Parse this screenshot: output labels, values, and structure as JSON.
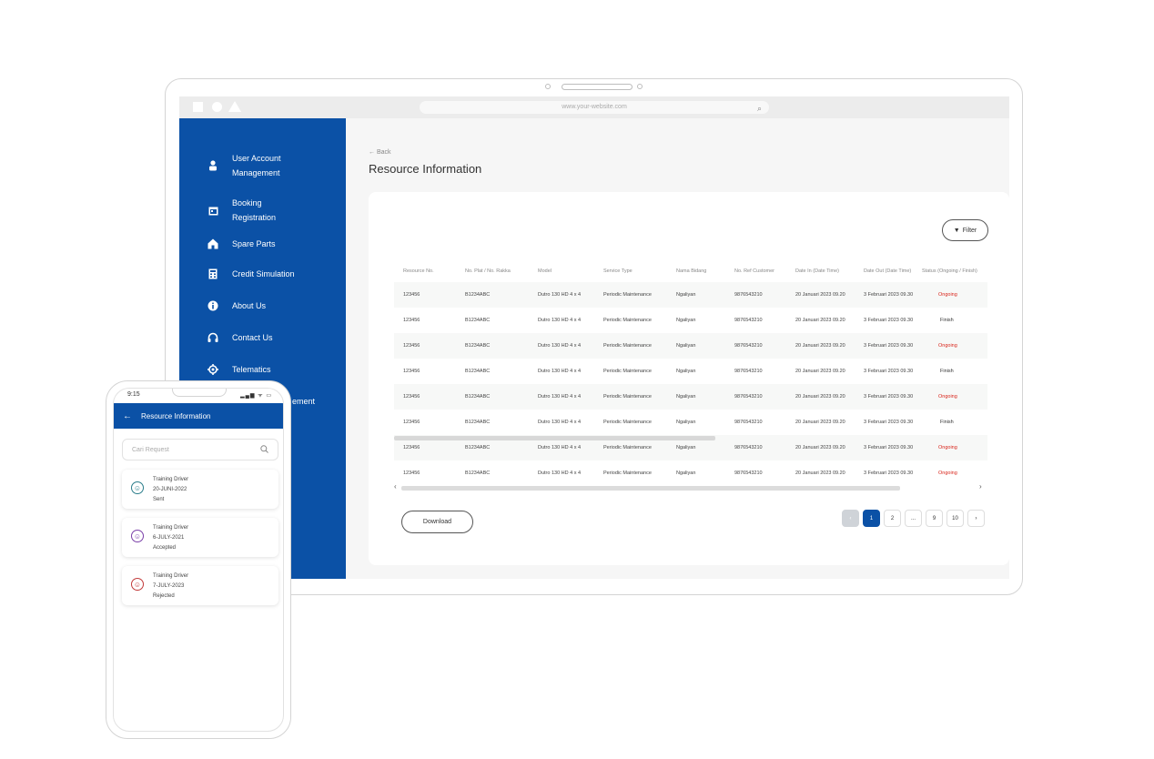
{
  "browser": {
    "url": "www.your-website.com"
  },
  "sidebar": {
    "items": [
      {
        "label": "User Account Management",
        "icon": "user-icon"
      },
      {
        "label": "Booking Registration",
        "icon": "calendar-icon"
      },
      {
        "label": "Spare Parts",
        "icon": "home-icon"
      },
      {
        "label": "Credit Simulation",
        "icon": "calculator-icon"
      },
      {
        "label": "About Us",
        "icon": "info-icon"
      },
      {
        "label": "Contact Us",
        "icon": "headset-icon"
      },
      {
        "label": "Telematics",
        "icon": "gear-icon"
      },
      {
        "label": "ement",
        "icon": ""
      }
    ]
  },
  "main": {
    "back_label": "Back",
    "title": "Resource Information",
    "filter_label": "Filter",
    "download_label": "Download",
    "table": {
      "headers": [
        "Resource No.",
        "No. Plat / No. Rakka",
        "Model",
        "Service Type",
        "Nama Bidang",
        "No. Ref Customer",
        "Date In (Date Time)",
        "Date Out (Date Time)",
        "Status (Ongoing / Finish)"
      ],
      "rows": [
        [
          "123456",
          "B1234ABC",
          "Dutro 130 HD 4 x 4",
          "Periodic Maintenance",
          "Ngaliyan",
          "9876543210",
          "20 Januari 2023 09.20",
          "3 Februari 2023 09.30",
          "Ongoing"
        ],
        [
          "123456",
          "B1234ABC",
          "Dutro 130 HD 4 x 4",
          "Periodic Maintenance",
          "Ngaliyan",
          "9876543210",
          "20 Januari 2023 09.20",
          "3 Februari 2023 09.30",
          "Finish"
        ],
        [
          "123456",
          "B1234ABC",
          "Dutro 130 HD 4 x 4",
          "Periodic Maintenance",
          "Ngaliyan",
          "9876543210",
          "20 Januari 2023 09.20",
          "3 Februari 2023 09.30",
          "Ongoing"
        ],
        [
          "123456",
          "B1234ABC",
          "Dutro 130 HD 4 x 4",
          "Periodic Maintenance",
          "Ngaliyan",
          "9876543210",
          "20 Januari 2023 09.20",
          "3 Februari 2023 09.30",
          "Finish"
        ],
        [
          "123456",
          "B1234ABC",
          "Dutro 130 HD 4 x 4",
          "Periodic Maintenance",
          "Ngaliyan",
          "9876543210",
          "20 Januari 2023 09.20",
          "3 Februari 2023 09.30",
          "Ongoing"
        ],
        [
          "123456",
          "B1234ABC",
          "Dutro 130 HD 4 x 4",
          "Periodic Maintenance",
          "Ngaliyan",
          "9876543210",
          "20 Januari 2023 09.20",
          "3 Februari 2023 09.30",
          "Finish"
        ],
        [
          "123456",
          "B1234ABC",
          "Dutro 130 HD 4 x 4",
          "Periodic Maintenance",
          "Ngaliyan",
          "9876543210",
          "20 Januari 2023 09.20",
          "3 Februari 2023 09.30",
          "Ongoing"
        ],
        [
          "123456",
          "B1234ABC",
          "Dutro 130 HD 4 x 4",
          "Periodic Maintenance",
          "Ngaliyan",
          "9876543210",
          "20 Januari 2023 09.20",
          "3 Februari 2023 09.30",
          "Ongoing"
        ]
      ]
    },
    "pagination": {
      "prev": "‹",
      "pages": [
        "1",
        "2",
        "...",
        "9",
        "10"
      ],
      "next": "›",
      "active": "1"
    }
  },
  "phone": {
    "time": "9:15",
    "indicators": "▂▄▆ ᯤ ▭",
    "header_title": "Resource Information",
    "search_placeholder": "Cari Request",
    "cards": [
      {
        "name": "Training Driver",
        "date": "20-JUNI-2022",
        "status": "Sent",
        "avatar_color": "#2a7d8a"
      },
      {
        "name": "Training Driver",
        "date": "6-JULY-2021",
        "status": "Accepted",
        "avatar_color": "#7a3fa8"
      },
      {
        "name": "Training Driver",
        "date": "7-JULY-2023",
        "status": "Rejected",
        "avatar_color": "#c23a3a"
      }
    ]
  },
  "colors": {
    "primary": "#0b51a6",
    "ongoing": "#d9261c"
  }
}
